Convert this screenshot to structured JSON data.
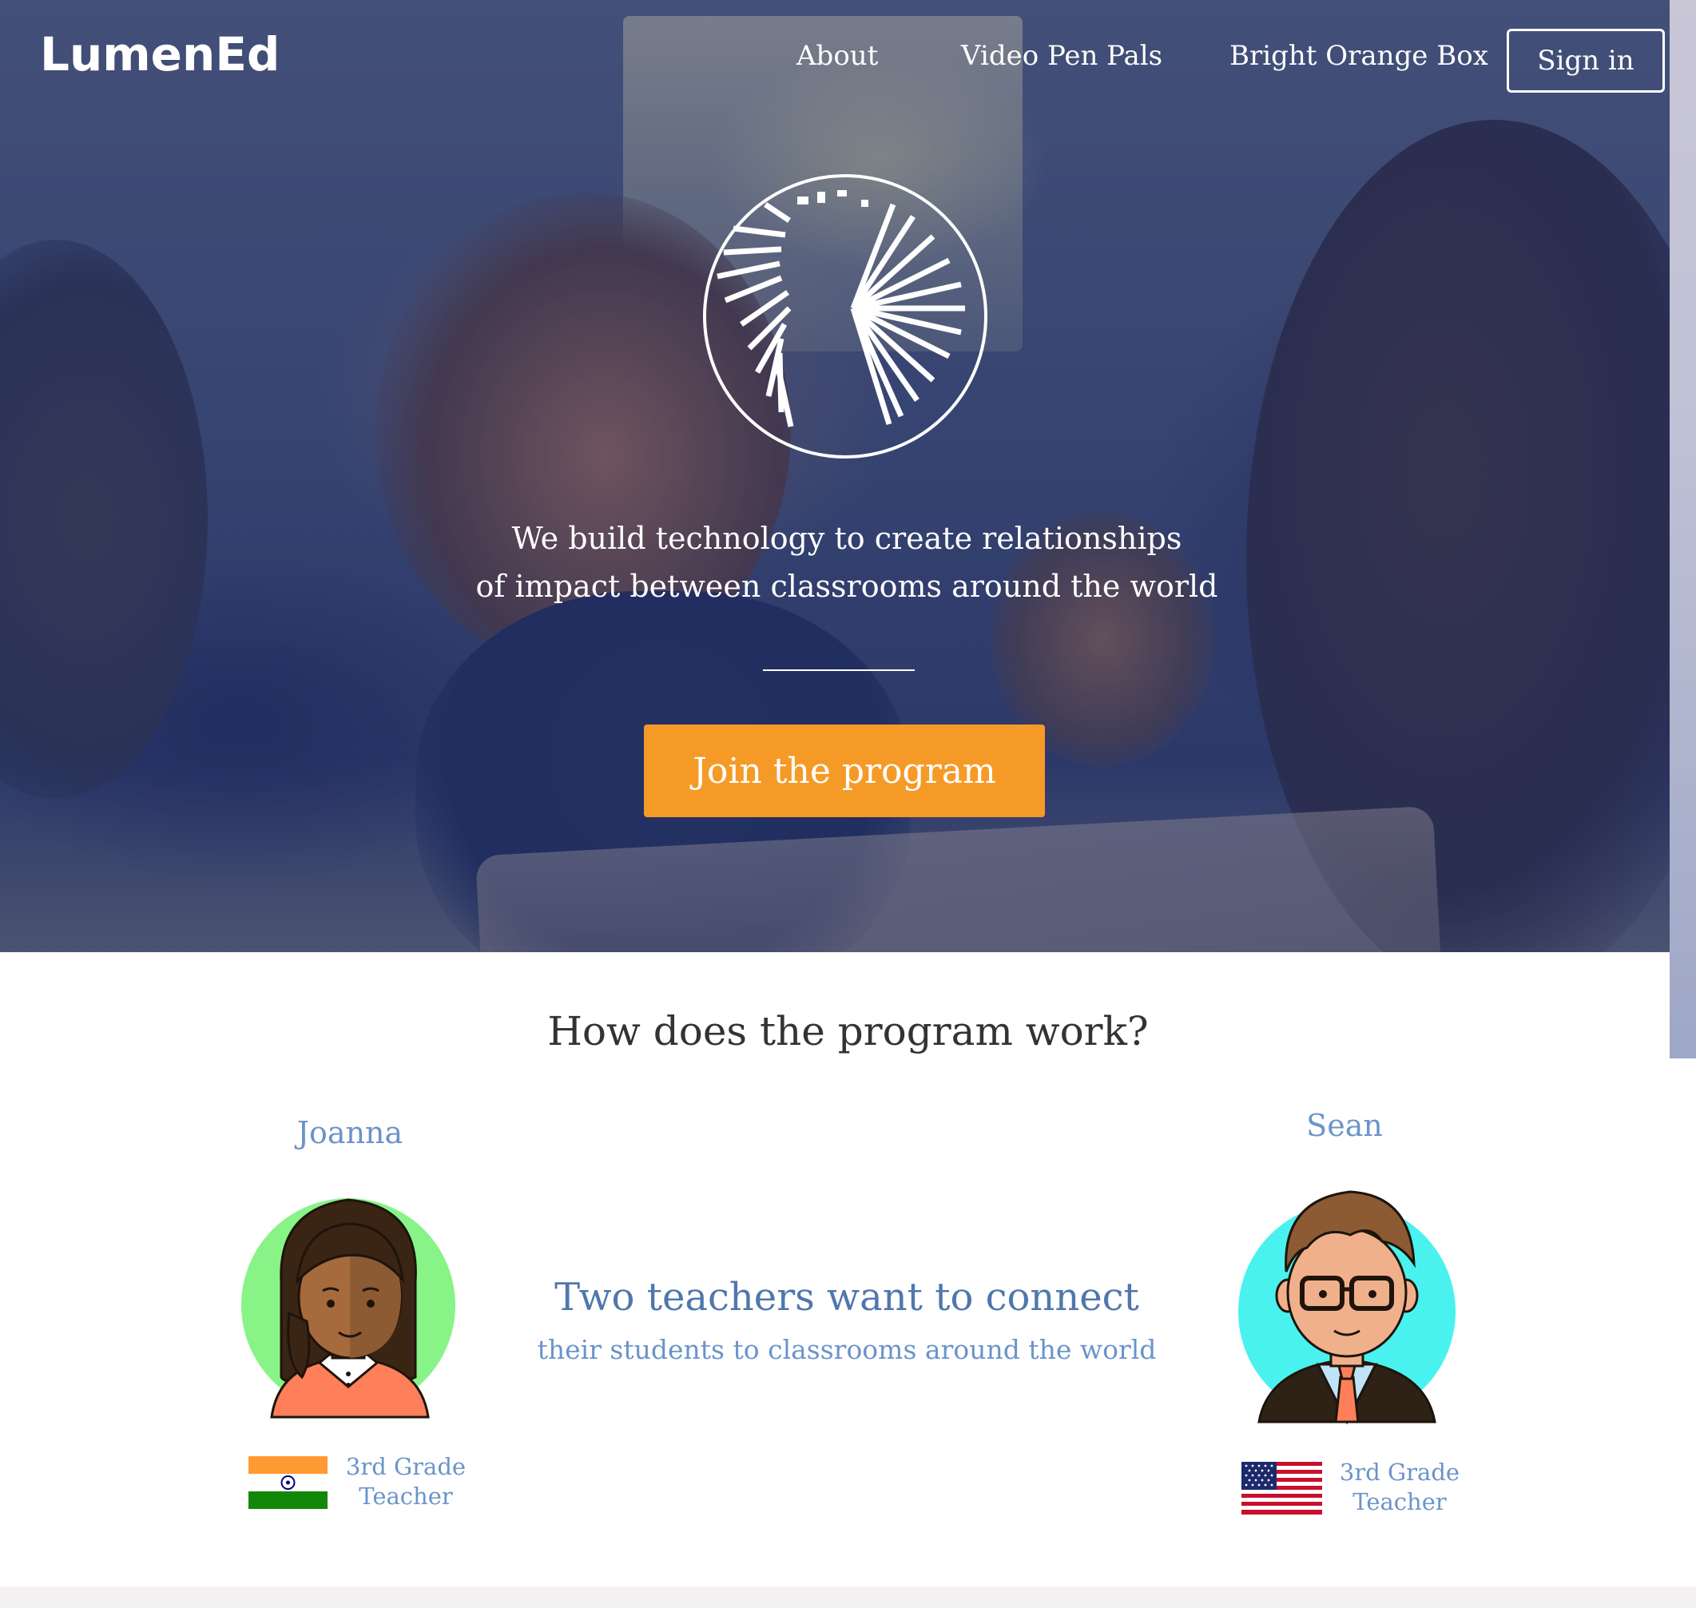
{
  "header": {
    "brand": "LumenEd",
    "nav": {
      "about": "About",
      "video_pen_pals": "Video Pen Pals",
      "bright_orange_box": "Bright Orange Box"
    },
    "sign_in": "Sign in"
  },
  "hero": {
    "tagline_line1": "We build technology to create relationships",
    "tagline_line2": "of impact between classrooms around the world",
    "cta": "Join the program"
  },
  "how_it_works": {
    "title": "How does the program work?",
    "headline": "Two teachers want to connect",
    "subline": "their students to classrooms around the world",
    "teachers": [
      {
        "name": "Joanna",
        "role_line1": "3rd Grade",
        "role_line2": "Teacher",
        "flag": "india-flag",
        "avatar_bg": "#88f487"
      },
      {
        "name": "Sean",
        "role_line1": "3rd Grade",
        "role_line2": "Teacher",
        "flag": "usa-flag",
        "avatar_bg": "#4af2ef"
      }
    ]
  },
  "colors": {
    "accent_orange": "#f59a26",
    "text_blue": "#6b94c9",
    "heading_blue": "#4f77ad"
  }
}
